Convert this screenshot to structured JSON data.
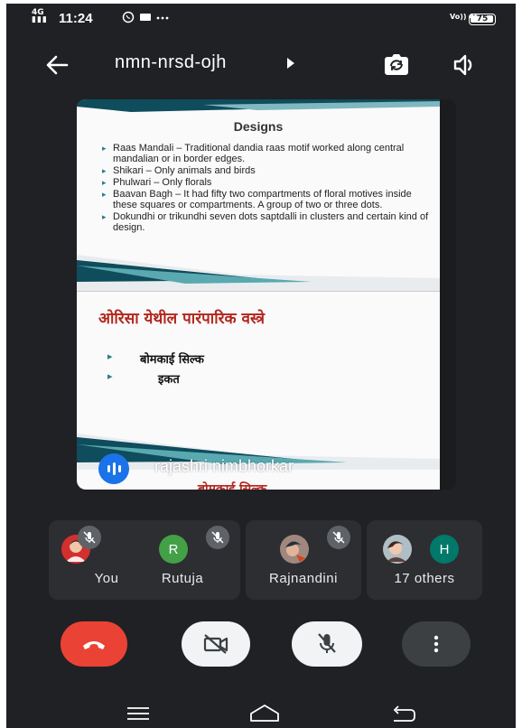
{
  "status_bar": {
    "signal_label": "4G",
    "time": "11:24",
    "right_indicators": "Vo)) 4G",
    "battery": "75"
  },
  "call": {
    "meeting_code": "nmn-nrsd-ojh",
    "icons": {
      "back": "arrow-left-icon",
      "switch_camera": "camera-switch-icon",
      "speaker": "speaker-icon",
      "caret": "caret-right-icon"
    }
  },
  "presentation": {
    "slide1": {
      "title": "Designs",
      "bullets": [
        "Raas Mandali – Traditional dandia raas motif worked along central mandalian or in border edges.",
        "Shikari – Only animals and birds",
        "Phulwari – Only florals",
        "Baavan Bagh – It had fifty two compartments of floral motives inside these squares or compartments. A group of two or three dots.",
        "Dokundhi or trikundhi seven dots saptdalli in clusters and certain kind of design."
      ]
    },
    "slide2": {
      "title": "ओरिसा येथील पारंपारिक वस्त्रे",
      "bullets": [
        "बोमकाई सिल्क",
        "इकत"
      ]
    },
    "slide3": {
      "title": "बोमकाई सिल्क"
    },
    "presenter_name": "rajashri nimbhorkar"
  },
  "participants": [
    {
      "name": "You",
      "avatar_type": "photo",
      "muted": true
    },
    {
      "name": "Rutuja",
      "initial": "R",
      "avatar_color": "#43a047",
      "muted": true
    },
    {
      "name": "Rajnandini",
      "avatar_type": "photo",
      "muted": true
    },
    {
      "name": "17 others",
      "initial": "H",
      "avatar_color": "#00796b",
      "avatar_type": "photo+initial"
    }
  ],
  "controls": {
    "end_call_icon": "phone-hangup-icon",
    "end_call_color": "#ea4335",
    "camera_icon": "camera-off-icon",
    "mic_icon": "mic-off-icon",
    "more_icon": "more-vert-icon"
  },
  "nav_bar": {
    "icons": [
      "menu-icon",
      "home-icon",
      "back-icon"
    ]
  }
}
